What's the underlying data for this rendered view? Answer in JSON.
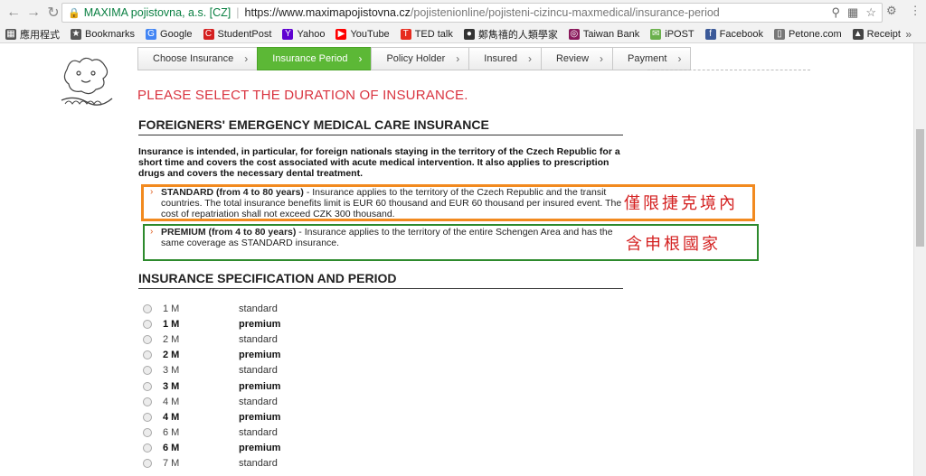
{
  "browser": {
    "secure_label": "MAXIMA pojistovna, a.s. [CZ]",
    "url_host": "https://www.maximapojistovna.cz",
    "url_path": "/pojistenionline/pojisteni-cizincu-maxmedical/insurance-period"
  },
  "bookmarks": [
    {
      "label": "應用程式",
      "icon": "apps-icon",
      "color": "#555555"
    },
    {
      "label": "Bookmarks",
      "icon": "star-icon",
      "color": "#555555"
    },
    {
      "label": "Google",
      "icon": "google-icon",
      "color": "#4285f4"
    },
    {
      "label": "StudentPost",
      "icon": "studentpost-icon",
      "color": "#d42020"
    },
    {
      "label": "Yahoo",
      "icon": "yahoo-icon",
      "color": "#5f01d1"
    },
    {
      "label": "YouTube",
      "icon": "youtube-icon",
      "color": "#ff0000"
    },
    {
      "label": "TED talk",
      "icon": "ted-icon",
      "color": "#e62b1e"
    },
    {
      "label": "鄭雋禧的人類學家",
      "icon": "blog-icon",
      "color": "#333333"
    },
    {
      "label": "Taiwan Bank",
      "icon": "bank-icon",
      "color": "#8a1a5c"
    },
    {
      "label": "iPOST",
      "icon": "ipost-icon",
      "color": "#6ab04c"
    },
    {
      "label": "Facebook",
      "icon": "facebook-icon",
      "color": "#3b5998"
    },
    {
      "label": "Petone.com",
      "icon": "page-icon",
      "color": "#777777"
    },
    {
      "label": "Receipt",
      "icon": "receipt-icon",
      "color": "#444444"
    }
  ],
  "bookmarks_more": "»",
  "steps": [
    {
      "label": "Choose Insurance",
      "active": false
    },
    {
      "label": "Insurance Period",
      "active": true
    },
    {
      "label": "Policy Holder",
      "active": false
    },
    {
      "label": "Insured",
      "active": false
    },
    {
      "label": "Review",
      "active": false
    },
    {
      "label": "Payment",
      "active": false
    }
  ],
  "page_heading": "PLEASE SELECT THE DURATION OF INSURANCE.",
  "section1_title": "FOREIGNERS' EMERGENCY MEDICAL CARE INSURANCE",
  "description": "Insurance is intended, in particular, for foreign nationals staying in the territory of the Czech Republic for a short time and covers the cost associated with acute medical intervention. It also applies to prescription drugs and covers the necessary dental treatment.",
  "standard": {
    "title": "STANDARD (from 4 to 80 years)",
    "text": " - Insurance applies to the territory of the Czech Republic and the transit countries. The total insurance benefits limit is EUR 60 thousand and EUR 60 thousand per insured event. The cost of repatriation shall not exceed CZK 300 thousand."
  },
  "premium": {
    "title": "PREMIUM (from 4 to 80 years)",
    "text": " - Insurance applies to the territory of the entire Schengen Area and has the same coverage as STANDARD insurance."
  },
  "annotations": {
    "orange_note": "僅限捷克境內",
    "green_note": "含申根國家",
    "orange_color": "#f28a1f",
    "green_color": "#2d8a2d"
  },
  "section2_title": "INSURANCE SPECIFICATION AND PERIOD",
  "periods": [
    {
      "months": "1 M",
      "type": "standard",
      "bold": false
    },
    {
      "months": "1 M",
      "type": "premium",
      "bold": true
    },
    {
      "months": "2 M",
      "type": "standard",
      "bold": false
    },
    {
      "months": "2 M",
      "type": "premium",
      "bold": true
    },
    {
      "months": "3 M",
      "type": "standard",
      "bold": false
    },
    {
      "months": "3 M",
      "type": "premium",
      "bold": true
    },
    {
      "months": "4 M",
      "type": "standard",
      "bold": false
    },
    {
      "months": "4 M",
      "type": "premium",
      "bold": true
    },
    {
      "months": "6 M",
      "type": "standard",
      "bold": false
    },
    {
      "months": "6 M",
      "type": "premium",
      "bold": true
    },
    {
      "months": "7 M",
      "type": "standard",
      "bold": false
    }
  ]
}
